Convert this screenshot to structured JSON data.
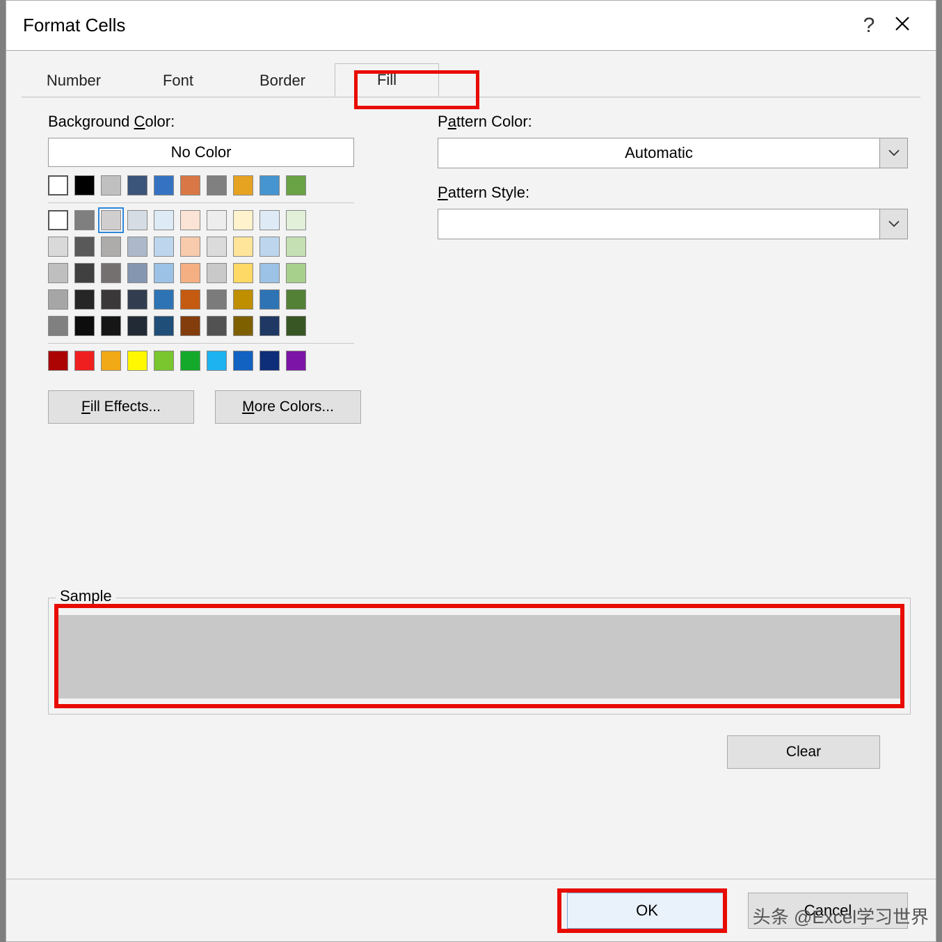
{
  "dialog": {
    "title": "Format Cells",
    "help_icon_char": "?",
    "close_icon_name": "close-icon"
  },
  "tabs": [
    {
      "label": "Number",
      "data_name": "tab-number",
      "active": false
    },
    {
      "label": "Font",
      "data_name": "tab-font",
      "active": false
    },
    {
      "label": "Border",
      "data_name": "tab-border",
      "active": false
    },
    {
      "label": "Fill",
      "data_name": "tab-fill",
      "active": true,
      "highlighted": true
    }
  ],
  "fill": {
    "bg_color_label_pre": "Background ",
    "bg_color_label_u": "C",
    "bg_color_label_post": "olor:",
    "no_color_label": "No Color",
    "selected_row": 1,
    "selected_col": 2,
    "theme_rows": [
      [
        "#FFFFFF",
        "#000000",
        "#C0C0C0",
        "#3B5479",
        "#3573C2",
        "#D97846",
        "#808080",
        "#E6A221",
        "#4795D0",
        "#6AA246"
      ],
      [
        "#FFFFFF",
        "#7F7F7F",
        "#D0CECE",
        "#D6DCE4",
        "#DEEAF6",
        "#FBE4D5",
        "#EDEDED",
        "#FFF2CC",
        "#DEEBF6",
        "#E2EFD9"
      ],
      [
        "#D9D9D9",
        "#595959",
        "#AEABAB",
        "#ADB9CA",
        "#BDD6EE",
        "#F7CBAC",
        "#DBDBDB",
        "#FEE599",
        "#BDD6EE",
        "#C5E0B3"
      ],
      [
        "#BFBFBF",
        "#404040",
        "#757070",
        "#8496B0",
        "#9CC2E5",
        "#F4B083",
        "#C9C9C9",
        "#FFD965",
        "#9CC2E5",
        "#A8D08D"
      ],
      [
        "#A6A6A6",
        "#262626",
        "#3A3838",
        "#323E4F",
        "#2E74B5",
        "#C55A11",
        "#7B7B7B",
        "#BF8F00",
        "#2E74B5",
        "#538135"
      ],
      [
        "#808080",
        "#0D0D0D",
        "#171616",
        "#222A35",
        "#1F4E79",
        "#833C0B",
        "#525252",
        "#7F6000",
        "#1F3864",
        "#385623"
      ]
    ],
    "standard_row": [
      "#AC0303",
      "#F01F1F",
      "#F2A916",
      "#FFF800",
      "#79C62F",
      "#14A92B",
      "#1DB2F0",
      "#1262C1",
      "#0F2E79",
      "#7C14A7"
    ],
    "fill_effects_label": "Fill Effects...",
    "more_colors_label": "More Colors...",
    "fill_effects_u": "F",
    "more_colors_u": "M"
  },
  "pattern": {
    "color_label_pre": "P",
    "color_label_u": "a",
    "color_label_post": "ttern Color:",
    "color_value": "Automatic",
    "style_label_pre": "",
    "style_label_u": "P",
    "style_label_post": "attern Style:",
    "style_value": ""
  },
  "sample": {
    "label": "Sample",
    "color": "#c8c8c8",
    "highlighted": true
  },
  "buttons": {
    "clear": "Clear",
    "ok": "OK",
    "cancel": "Cancel",
    "ok_highlighted": true
  },
  "watermark": "头条 @Excel学习世界"
}
